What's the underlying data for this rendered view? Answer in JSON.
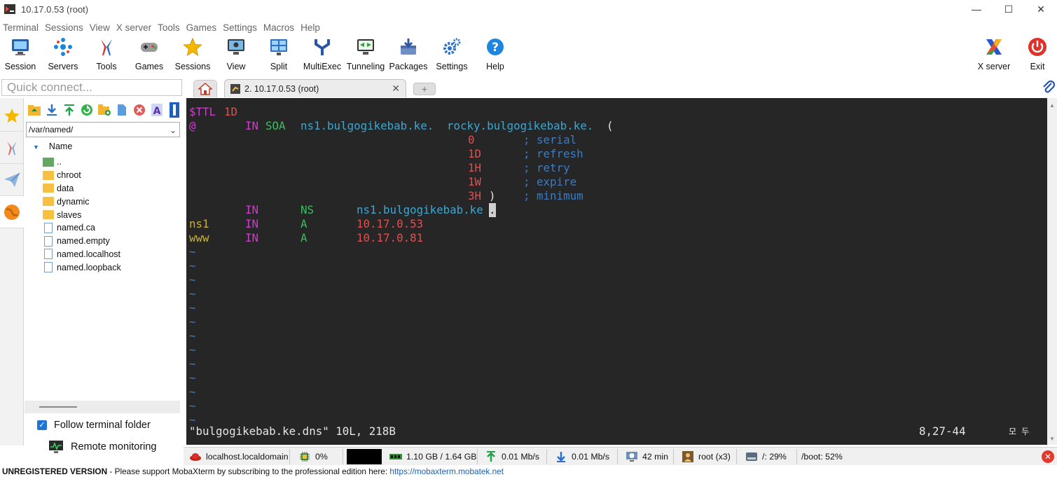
{
  "window": {
    "title": "10.17.0.53 (root)",
    "minimize": "—",
    "maximize": "☐",
    "close": "✕"
  },
  "menu": [
    "Terminal",
    "Sessions",
    "View",
    "X server",
    "Tools",
    "Games",
    "Settings",
    "Macros",
    "Help"
  ],
  "toolbar": {
    "session": "Session",
    "servers": "Servers",
    "tools": "Tools",
    "games": "Games",
    "sessions": "Sessions",
    "view": "View",
    "split": "Split",
    "multiexec": "MultiExec",
    "tunneling": "Tunneling",
    "packages": "Packages",
    "settings": "Settings",
    "help": "Help",
    "xserver": "X server",
    "exit": "Exit"
  },
  "quick_connect": {
    "placeholder": "Quick connect..."
  },
  "tabs": {
    "active_label": "2. 10.17.0.53 (root)",
    "close_glyph": "✕",
    "new_glyph": "+"
  },
  "file_browser": {
    "path": "/var/named/",
    "column_header": "Name",
    "items": [
      {
        "name": "..",
        "kind": "up"
      },
      {
        "name": "chroot",
        "kind": "folder"
      },
      {
        "name": "data",
        "kind": "folder"
      },
      {
        "name": "dynamic",
        "kind": "folder"
      },
      {
        "name": "slaves",
        "kind": "folder"
      },
      {
        "name": "named.ca",
        "kind": "file"
      },
      {
        "name": "named.empty",
        "kind": "file"
      },
      {
        "name": "named.localhost",
        "kind": "file"
      },
      {
        "name": "named.loopback",
        "kind": "file"
      }
    ],
    "follow_terminal_folder": "Follow terminal folder",
    "follow_checked": true,
    "remote_monitoring": "Remote monitoring"
  },
  "terminal": {
    "l1": {
      "a": "$TTL",
      "b": "1D"
    },
    "l2": {
      "a": "@",
      "b": "IN",
      "c": "SOA",
      "d": "ns1.bulgogikebab.ke.",
      "e": "rocky.bulgogikebab.ke.",
      "f": "("
    },
    "l3": {
      "v": "0",
      "c": "; serial"
    },
    "l4": {
      "v": "1D",
      "c": "; refresh"
    },
    "l5": {
      "v": "1H",
      "c": "; retry"
    },
    "l6": {
      "v": "1W",
      "c": "; expire"
    },
    "l7": {
      "v": "3H",
      "p": ")",
      "c": "; minimum"
    },
    "l8": {
      "b": "IN",
      "c": "NS",
      "d": "ns1.bulgogikebab.ke",
      "cur": "."
    },
    "l9": {
      "a": "ns1",
      "b": "IN",
      "c": "A",
      "d": "10.17.0.53"
    },
    "l10": {
      "a": "www",
      "b": "IN",
      "c": "A",
      "d": "10.17.0.81"
    },
    "tilde": "~",
    "status_left": "\"bulgogikebab.ke.dns\" 10L, 218B",
    "status_pos": "8,27-44",
    "status_ime": "모 두"
  },
  "statusbar": {
    "host": "localhost.localdomain",
    "cpu": "0%",
    "memory": "1.10 GB / 1.64 GB",
    "upload": "0.01 Mb/s",
    "download": "0.01 Mb/s",
    "uptime": "42 min",
    "users": "root (x3)",
    "disk_root": "/: 29%",
    "disk_boot": "/boot: 52%"
  },
  "footer": {
    "unregistered": "UNREGISTERED VERSION",
    "message": " -  Please support MobaXterm by subscribing to the professional edition here:  ",
    "link": "https://mobaxterm.mobatek.net"
  },
  "colors": {
    "terminal_bg": "#262626",
    "accent": "#1e73d8",
    "keyword": "#d23ad2",
    "number": "#e05050",
    "rtype": "#3cbd63",
    "comment": "#3aa7d4"
  }
}
